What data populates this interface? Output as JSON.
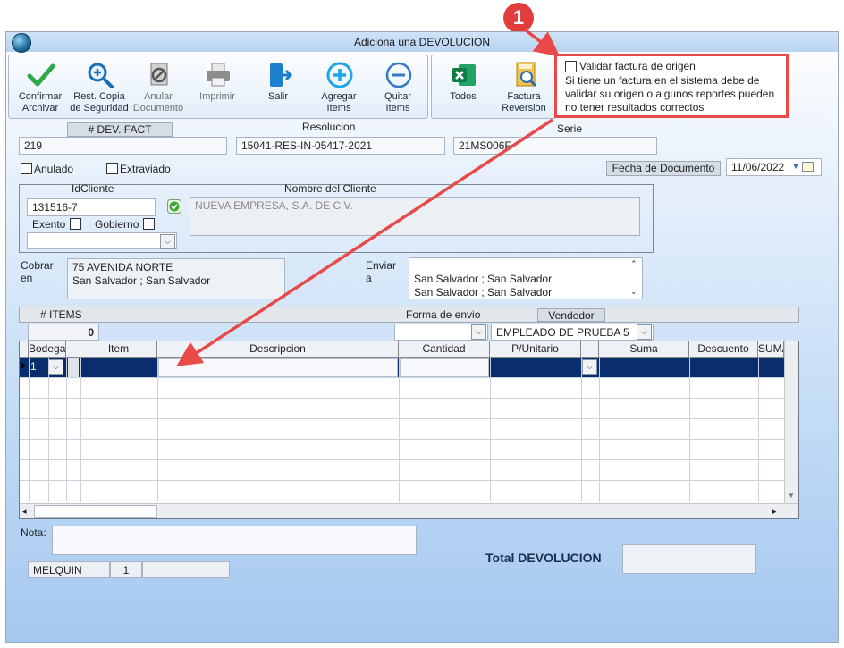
{
  "window": {
    "title": "Adiciona una DEVOLUCION"
  },
  "toolbar": {
    "confirm": "Confirmar\nArchivar",
    "restore": "Rest. Copia\nde Seguridad",
    "void": "Anular\nDocumento",
    "print": "Imprimir",
    "exit": "Salir",
    "add_items": "Agregar\nItems",
    "remove_items": "Quitar\nItems",
    "all": "Todos",
    "invoice_reversal": "Factura\nReversion"
  },
  "callout": {
    "badge": "1",
    "checkbox_label": "Validar factura de origen",
    "note": "Si tiene un factura en el sistema debe de validar su origen o algunos reportes pueden no tener resultados correctos"
  },
  "header": {
    "dev_fact_label": "# DEV. FACT",
    "dev_fact_value": "219",
    "resolution_label": "Resolucion",
    "resolution_value": "15041-RES-IN-05417-2021",
    "series_label": "Serie",
    "series_value": "21MS006F",
    "anulado": "Anulado",
    "extraviado": "Extraviado",
    "doc_date_label": "Fecha de  Documento",
    "doc_date_value": "11/06/2022"
  },
  "client": {
    "id_label": "IdCliente",
    "id_value": "131516-7",
    "name_label": "Nombre del Cliente",
    "name_value": "NUEVA EMPRESA, S.A. DE C.V.",
    "exento": "Exento",
    "gobierno": "Gobierno",
    "charge_label": "Cobrar\nen",
    "charge_line1": "75 AVENIDA NORTE",
    "charge_line2": "San Salvador ; San Salvador",
    "send_label": "Enviar\na",
    "send_line1": "San Salvador ; San Salvador",
    "send_line2": "San Salvador ; San Salvador"
  },
  "items_bar": {
    "items_label": "# ITEMS",
    "items_count": "0",
    "shipping_label": "Forma de envio",
    "seller_label": "Vendedor",
    "seller_value": "EMPLEADO DE PRUEBA 5"
  },
  "grid": {
    "columns": [
      "Bodega",
      "Item",
      "Descripcion",
      "Cantidad",
      "P/Unitario",
      "Suma",
      "Descuento",
      "SUMA"
    ],
    "first_row_bodega": "1"
  },
  "footer": {
    "note_label": "Nota:",
    "user": "MELQUIN",
    "user_num": "1",
    "total_label": "Total DEVOLUCION"
  },
  "colors": {
    "accent_red": "#e84a4a",
    "selected_row": "#0a2d6e"
  }
}
